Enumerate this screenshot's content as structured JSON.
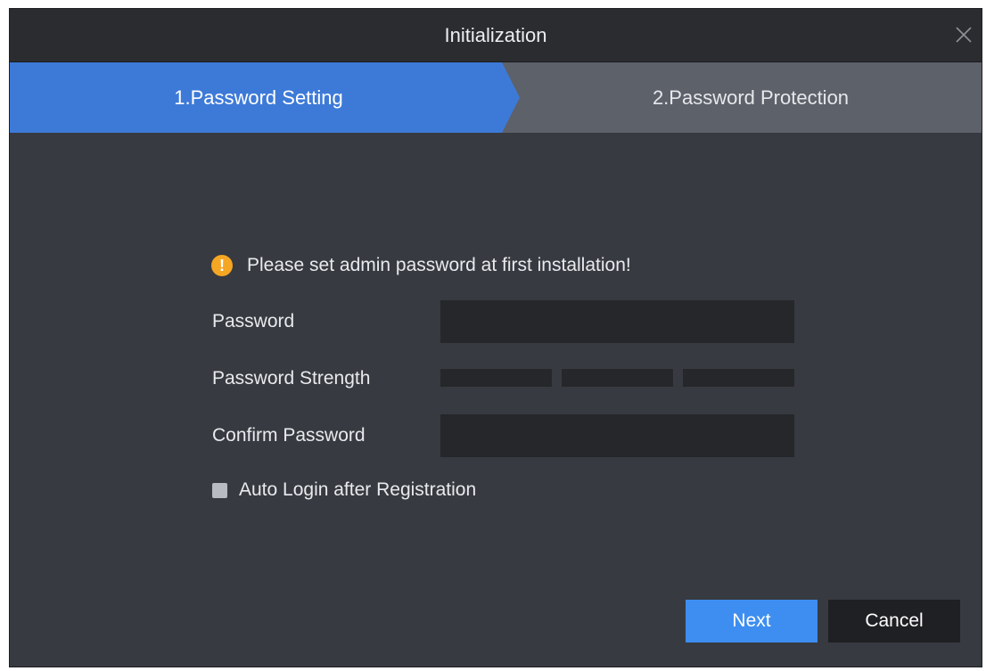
{
  "window": {
    "title": "Initialization"
  },
  "steps": [
    {
      "label": "1.Password Setting",
      "active": true
    },
    {
      "label": "2.Password Protection",
      "active": false
    }
  ],
  "notice": {
    "text": "Please set admin password at first installation!"
  },
  "form": {
    "password_label": "Password",
    "password_value": "",
    "strength_label": "Password Strength",
    "strength_segments": 3,
    "strength_level": 0,
    "confirm_label": "Confirm Password",
    "confirm_value": "",
    "auto_login_label": "Auto Login after Registration",
    "auto_login_checked": false
  },
  "buttons": {
    "next": "Next",
    "cancel": "Cancel"
  },
  "colors": {
    "accent": "#3d8ef0",
    "active_step": "#3d7ad8",
    "inactive_step": "#5d616a",
    "warning": "#f5a623",
    "background": "#373a40"
  }
}
